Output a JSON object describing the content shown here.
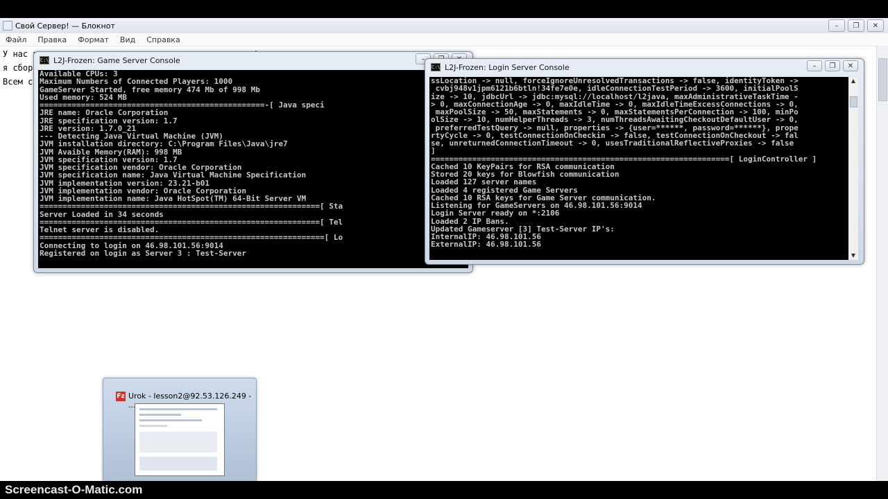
{
  "notepad": {
    "title": "Свой Сервер! — Блокнот",
    "menu": [
      "Файл",
      "Правка",
      "Формат",
      "Вид",
      "Справка"
    ],
    "lines": [
      "У нас все готово, осталось только запустить сервер!",
      "я сбор",
      "Всем с"
    ]
  },
  "game_console": {
    "title": "L2J-Frozen: Game Server Console",
    "lines": [
      "Available CPUs: 3",
      "Maximum Numbers of Connected Players: 1000",
      "GameServer Started, free memory 474 Mb of 998 Mb",
      "Used memory: 524 MB",
      "=================================================-[ Java speci",
      "JRE name: Oracle Corporation",
      "JRE specification version: 1.7",
      "JRE version: 1.7.0_21",
      "--- Detecting Java Virtual Machine (JVM)",
      "JVM installation directory: C:\\Program Files\\Java\\jre7",
      "JVM Avaible Memory(RAM): 998 MB",
      "JVM specification version: 1.7",
      "JVM specification vendor: Oracle Corporation",
      "JVM specification name: Java Virtual Machine Specification",
      "JVM implementation version: 23.21-b01",
      "JVM implementation vendor: Oracle Corporation",
      "JVM implementation name: Java HotSpot(TM) 64-Bit Server VM",
      "=============================================================[ Sta",
      "Server Loaded in 34 seconds",
      "=============================================================[ Tel",
      "Telnet server is disabled.",
      "==============================================================[ Lo",
      "Connecting to login on 46.98.101.56:9014",
      "Registered on login as Server 3 : Test-Server"
    ]
  },
  "login_console": {
    "title": "L2J-Frozen: Login Server Console",
    "lines": [
      "ssLocation -> null, forceIgnoreUnresolvedTransactions -> false, identityToken ->",
      " cvbj948v1jpm6121b6btln!34fe7e0e, idleConnectionTestPeriod -> 3600, initialPoolS",
      "ize -> 10, jdbcUrl -> jdbc:mysql://localhost/l2java, maxAdministrativeTaskTime -",
      "> 0, maxConnectionAge -> 0, maxIdleTime -> 0, maxIdleTimeExcessConnections -> 0,",
      " maxPoolSize -> 50, maxStatements -> 0, maxStatementsPerConnection -> 100, minPo",
      "olSize -> 10, numHelperThreads -> 3, numThreadsAwaitingCheckoutDefaultUser -> 0,",
      " preferredTestQuery -> null, properties -> {user=******, password=******}, prope",
      "rtyCycle -> 0, testConnectionOnCheckin -> false, testConnectionOnCheckout -> fal",
      "se, unreturnedConnectionTimeout -> 0, usesTraditionalReflectiveProxies -> false",
      "]",
      "=================================================================[ LoginController ]",
      "Cached 10 KeyPairs for RSA communication",
      "Stored 20 keys for Blowfish communication",
      "Loaded 127 server names",
      "Loaded 4 registered Game Servers",
      "Cached 10 RSA keys for Game Server communication.",
      "Listening for GameServers on 46.98.101.56:9014",
      "Login Server ready on *:2106",
      "Loaded 2 IP Bans.",
      "Updated Gameserver [3] Test-Server IP's:",
      "InternalIP: 46.98.101.56",
      "ExternalIP: 46.98.101.56"
    ]
  },
  "taskbar_preview": {
    "title": "Urok - lesson2@92.53.126.249 - ..."
  },
  "watermark": "Screencast-O-Matic.com",
  "icons": {
    "console": "console-icon",
    "filezilla": "filezilla-icon"
  }
}
